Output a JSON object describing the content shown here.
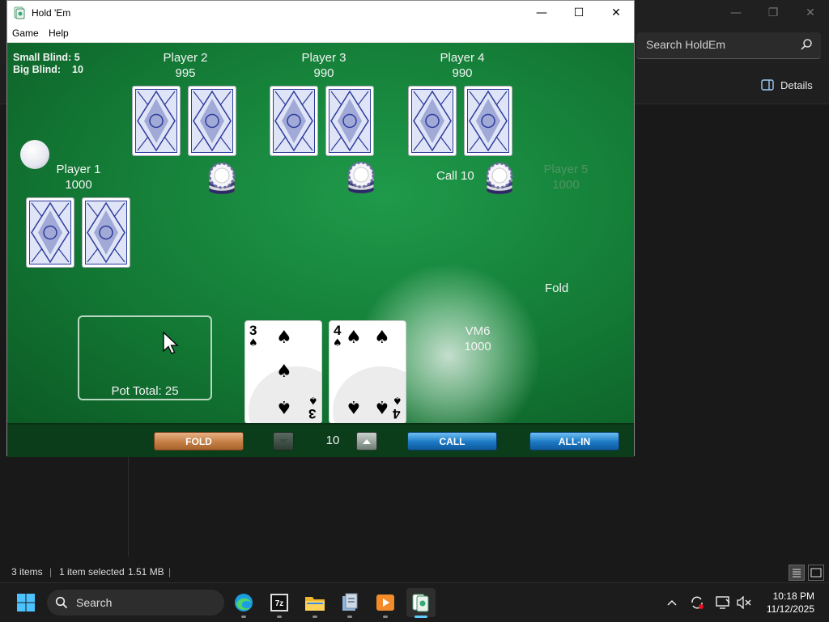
{
  "explorer": {
    "search_placeholder": "Search HoldEm",
    "details_label": "Details",
    "status": {
      "items": "3 items",
      "selected": "1 item selected",
      "size": "1.51 MB"
    }
  },
  "window": {
    "title": "Hold 'Em",
    "menu": [
      "Game",
      "Help"
    ]
  },
  "table": {
    "blinds": {
      "small": "Small Blind: 5",
      "big_label": "Big Blind:",
      "big_value": "10"
    },
    "players": [
      {
        "name": "Player 1",
        "chips": "1000"
      },
      {
        "name": "Player 2",
        "chips": "995"
      },
      {
        "name": "Player 3",
        "chips": "990"
      },
      {
        "name": "Player 4",
        "chips": "990"
      },
      {
        "name": "Player 5",
        "chips": "1000"
      },
      {
        "name": "VM6",
        "chips": "1000"
      }
    ],
    "call_text": "Call 10",
    "fold_text": "Fold",
    "pot_total": "Pot Total: 25",
    "hand": [
      {
        "rank": "3",
        "suit": "spades",
        "suit_glyph": "♠"
      },
      {
        "rank": "4",
        "suit": "spades",
        "suit_glyph": "♠"
      }
    ],
    "bet_amount": "10",
    "buttons": {
      "fold": "FOLD",
      "call": "CALL",
      "all_in": "ALL-IN"
    }
  },
  "taskbar": {
    "search_label": "Search",
    "apps": [
      "start-icon",
      "edge-icon",
      "7zip-icon",
      "file-explorer-icon",
      "app-icon",
      "media-player-icon",
      "holdem-icon"
    ],
    "tray": [
      "chevron-up-icon",
      "sync-icon",
      "display-icon",
      "volume-muted-icon"
    ],
    "time": "10:18 PM",
    "date": "11/12/2025"
  },
  "colors": {
    "felt": "#137a35",
    "fold_button": "#c47f45",
    "blue_button": "#1c78c4",
    "card_back": "#2d3b9c"
  }
}
